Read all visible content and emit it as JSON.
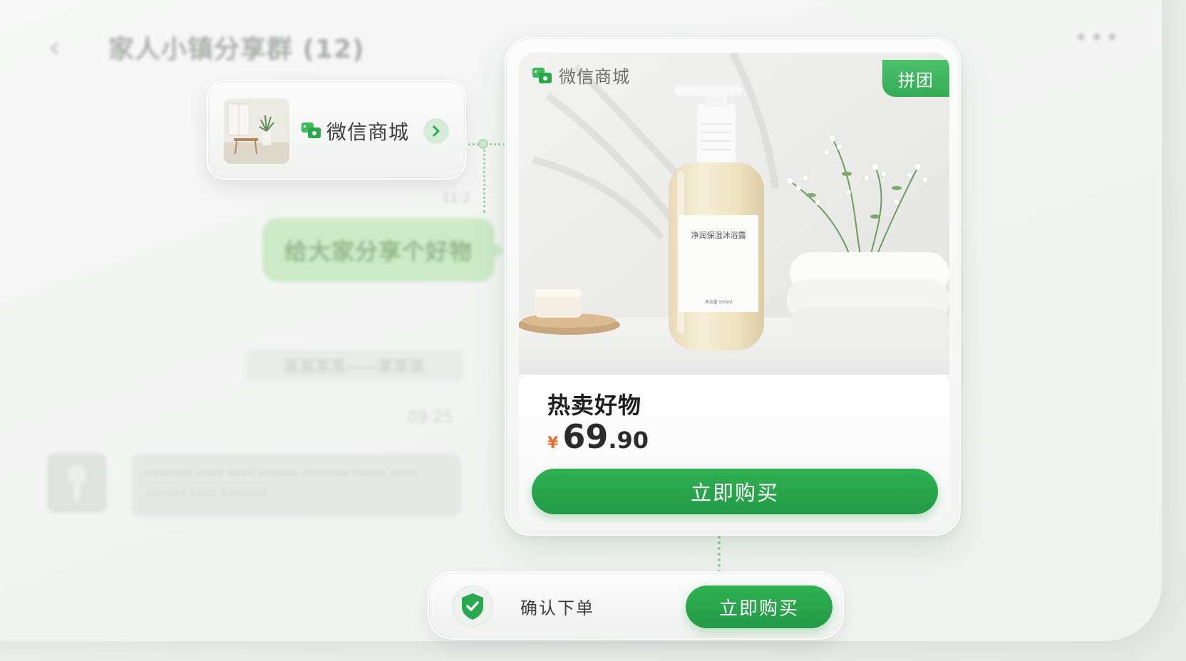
{
  "chat_background": {
    "back_icon": "chevron-left-icon",
    "title": "家人小镇分享群 (12)",
    "more_icon": "more-dots-icon",
    "time_1": "11:2",
    "shared_message": "给大家分享个好物",
    "system_notice": "某某某某——某某某",
    "time_2": "09:25",
    "incoming_message": "xxxxxxx xxxx xxxx xxxxxx xxxxxxx xxxxx xxxx xxxxxx xxxx xxxxxxx"
  },
  "link_card": {
    "logo_icon": "wechat-shop-icon",
    "label": "微信商城",
    "chevron_icon": "chevron-right-icon"
  },
  "product_card": {
    "shop_label": "微信商城",
    "badge": "拼团",
    "bottle_label": "净润保湿沐浴露",
    "bottle_volume": "净含量 550ml",
    "title": "热卖好物",
    "price": {
      "currency": "¥",
      "integer": "69",
      "decimal": ".90"
    },
    "buy_button": "立即购买"
  },
  "confirm_bar": {
    "shield_icon": "shield-check-icon",
    "label": "确认下单",
    "button": "立即购买"
  },
  "colors": {
    "brand_green": "#2aa84e",
    "price_accent": "#e5702a",
    "bubble_green": "#cdeac7"
  }
}
